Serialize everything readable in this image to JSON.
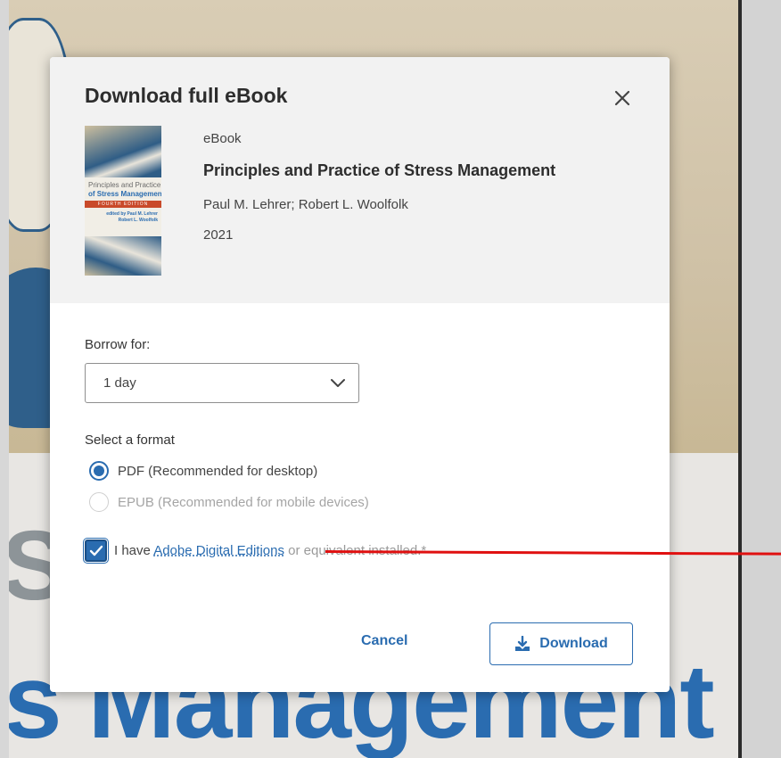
{
  "background": {
    "letter": "S",
    "title_fragment": "s Management"
  },
  "book_cover": {
    "line1": "Principles and Practice",
    "line2": "of Stress Management",
    "edition": "FOURTH EDITION",
    "editors": "edited by Paul M. Lehrer\nRobert L. Woolfolk"
  },
  "modal": {
    "title": "Download full eBook",
    "close_label": "Close",
    "book": {
      "type": "eBook",
      "title": "Principles and Practice of Stress Management",
      "authors": "Paul M. Lehrer; Robert L. Woolfolk",
      "year": "2021"
    },
    "borrow": {
      "label": "Borrow for:",
      "selected": "1 day"
    },
    "format": {
      "label": "Select a format",
      "options": [
        {
          "label": "PDF (Recommended for desktop)",
          "selected": true,
          "enabled": true
        },
        {
          "label": "EPUB (Recommended for mobile devices)",
          "selected": false,
          "enabled": false
        }
      ]
    },
    "agreement": {
      "checked": true,
      "prefix": "I have ",
      "link": "Adobe Digital Editions",
      "suffix": " or equivalent installed.*"
    },
    "actions": {
      "cancel": "Cancel",
      "download": "Download"
    }
  },
  "colors": {
    "accent": "#2a6cb0",
    "annotation": "#e01010"
  }
}
